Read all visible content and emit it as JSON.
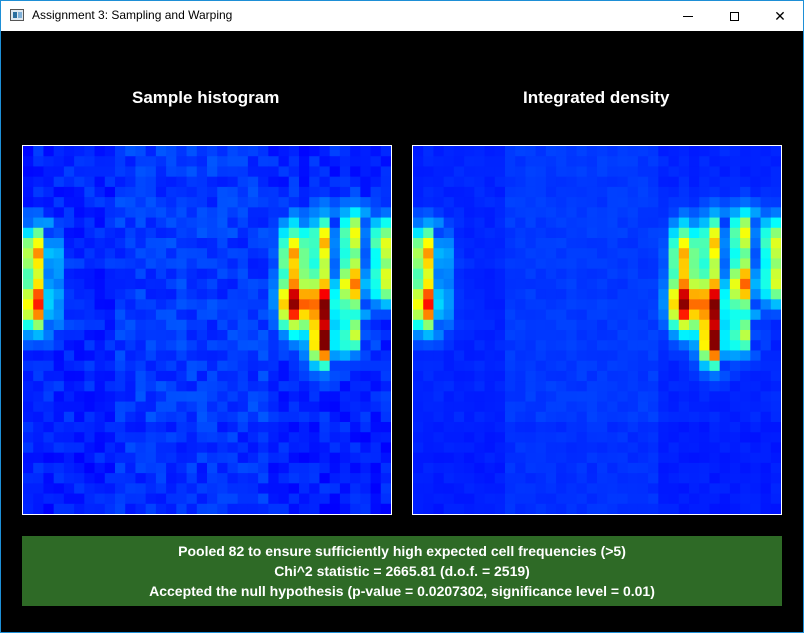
{
  "window": {
    "title": "Assignment 3: Sampling and Warping",
    "minimize_icon": "minimize-icon",
    "maximize_icon": "maximize-icon",
    "close_icon": "close-icon",
    "close_glyph": "✕"
  },
  "panels": {
    "left_title": "Sample histogram",
    "right_title": "Integrated density"
  },
  "results": {
    "line1": "Pooled 82 to ensure sufficiently high expected cell frequencies (>5)",
    "line2": "Chi^2 statistic = 2665.81 (d.o.f. = 2519)",
    "line3": "Accepted the null hypothesis (p-value = 0.0207302, significance level = 0.01)",
    "background_color": "#2e6a26"
  },
  "colors": {
    "border_accent": "#1e8fd6",
    "heatmap_base": "#1a2cf2"
  }
}
